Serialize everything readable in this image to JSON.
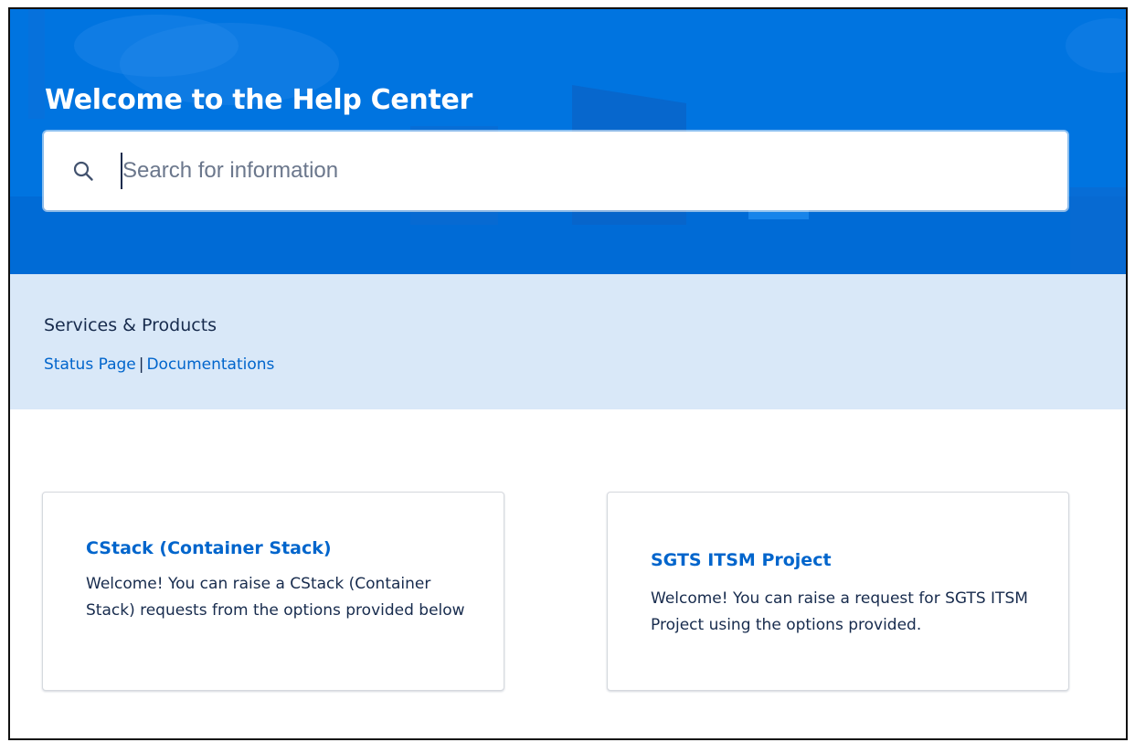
{
  "hero": {
    "title": "Welcome to the Help Center",
    "background_color": "#0074e0"
  },
  "search": {
    "placeholder": "Search for information",
    "icon": "search-icon"
  },
  "services": {
    "title": "Services & Products",
    "links": [
      "Status Page",
      "Documentations"
    ],
    "separator": "|",
    "background_color": "#d9e8f8"
  },
  "cards": [
    {
      "title": "CStack (Container Stack)",
      "description": "Welcome! You can raise a CStack (Container Stack) requests from the options provided below"
    },
    {
      "title": "SGTS ITSM Project",
      "description": "Welcome! You can raise a request for SGTS ITSM Project using the options provided."
    }
  ],
  "colors": {
    "link": "#0065cc",
    "text": "#172b4d"
  }
}
